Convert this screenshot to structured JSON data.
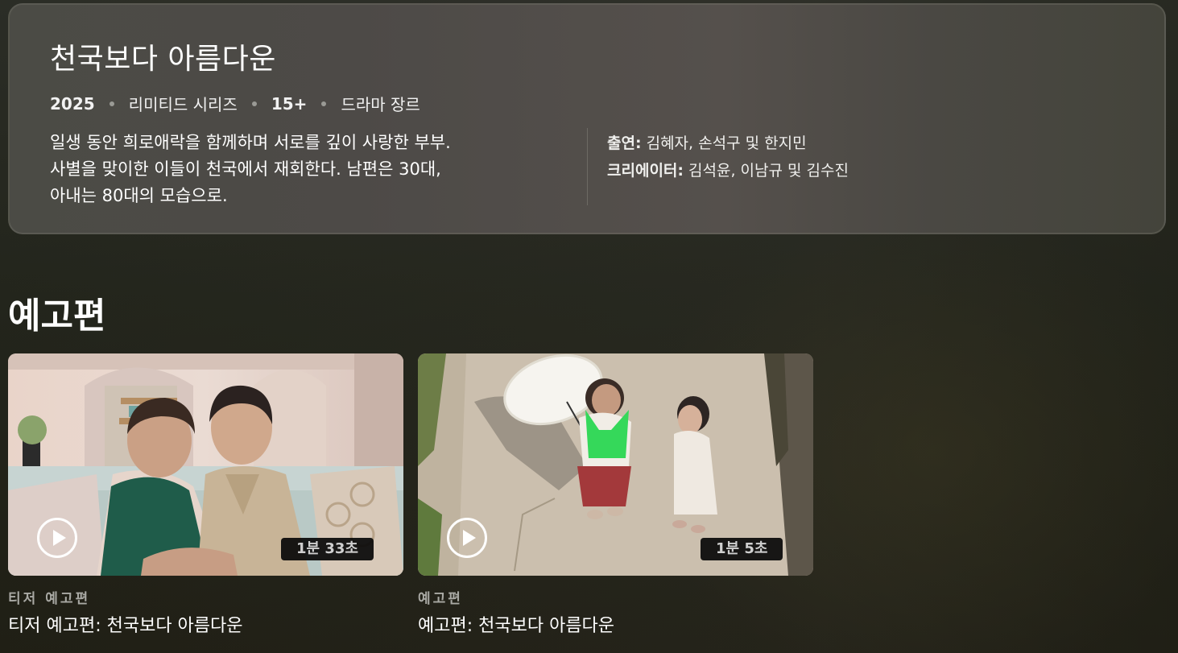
{
  "show": {
    "title": "천국보다 아름다운",
    "meta": {
      "year": "2025",
      "format": "리미티드 시리즈",
      "rating": "15+",
      "genre": "드라마 장르"
    },
    "description_lines": [
      "일생 동안 희로애락을 함께하며 서로를 깊이 사랑한 부부.",
      "사별을 맞이한 이들이 천국에서 재회한다. 남편은 30대,",
      "아내는 80대의 모습으로."
    ],
    "credits": {
      "cast_label": "출연:",
      "cast_value": " 김혜자, 손석구 및 한지민",
      "creators_label": "크리에이터:",
      "creators_value": " 김석윤, 이남규 및 김수진"
    }
  },
  "trailers": {
    "section_title": "예고편",
    "items": [
      {
        "type_label": "티저 예고편",
        "title": "티저 예고편: 천국보다 아름다운",
        "duration": "1분 33초",
        "play_icon": "play-icon"
      },
      {
        "type_label": "예고편",
        "title": "예고편: 천국보다 아름다운",
        "duration": "1분 5초",
        "play_icon": "play-icon"
      }
    ]
  },
  "colors": {
    "panel": "#4d4a47",
    "background": "#23251c",
    "text": "#ffffff",
    "muted": "#a9a9a4"
  }
}
